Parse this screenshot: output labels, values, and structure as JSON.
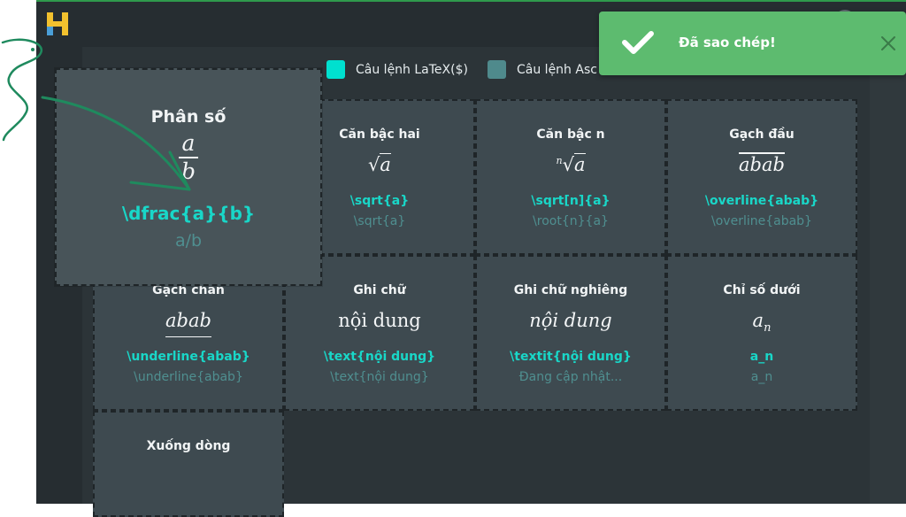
{
  "legend": {
    "latex_label": "Câu lệnh LaTeX($)",
    "ascii_label": "Câu lệnh Asc",
    "latex_color": "#00e0cf",
    "ascii_color": "#4f8a8c"
  },
  "toast": {
    "message": "Đã sao chép!",
    "color": "#5dbb6f"
  },
  "hover_card": {
    "title": "Phân số",
    "num": "a",
    "den": "b",
    "latex": "\\dfrac{a}{b}",
    "ascii": "a/b"
  },
  "cards": {
    "sqrt": {
      "title": "Căn bậc hai",
      "math": "a",
      "latex": "\\sqrt{a}",
      "ascii": "\\sqrt{a}"
    },
    "root": {
      "title": "Căn bậc n",
      "idx": "n",
      "math": "a",
      "latex": "\\sqrt[n]{a}",
      "ascii": "\\root{n}{a}"
    },
    "overline": {
      "title": "Gạch đầu",
      "math": "abab",
      "latex": "\\overline{abab}",
      "ascii": "\\overline{abab}"
    },
    "underline": {
      "title": "Gạch chân",
      "math": "abab",
      "latex": "\\underline{abab}",
      "ascii": "\\underline{abab}"
    },
    "text": {
      "title": "Ghi chữ",
      "math": "nội dung",
      "latex": "\\text{nội dung}",
      "ascii": "\\text{nội dung}"
    },
    "textit": {
      "title": "Ghi chữ nghiêng",
      "math": "nội dung",
      "latex": "\\textit{nội dung}",
      "ascii": "Đang cập nhật..."
    },
    "subscript": {
      "title": "Chỉ số dưới",
      "base": "a",
      "sub": "n",
      "latex": "a_n",
      "ascii": "a_n"
    },
    "newline": {
      "title": "Xuống dòng"
    }
  }
}
